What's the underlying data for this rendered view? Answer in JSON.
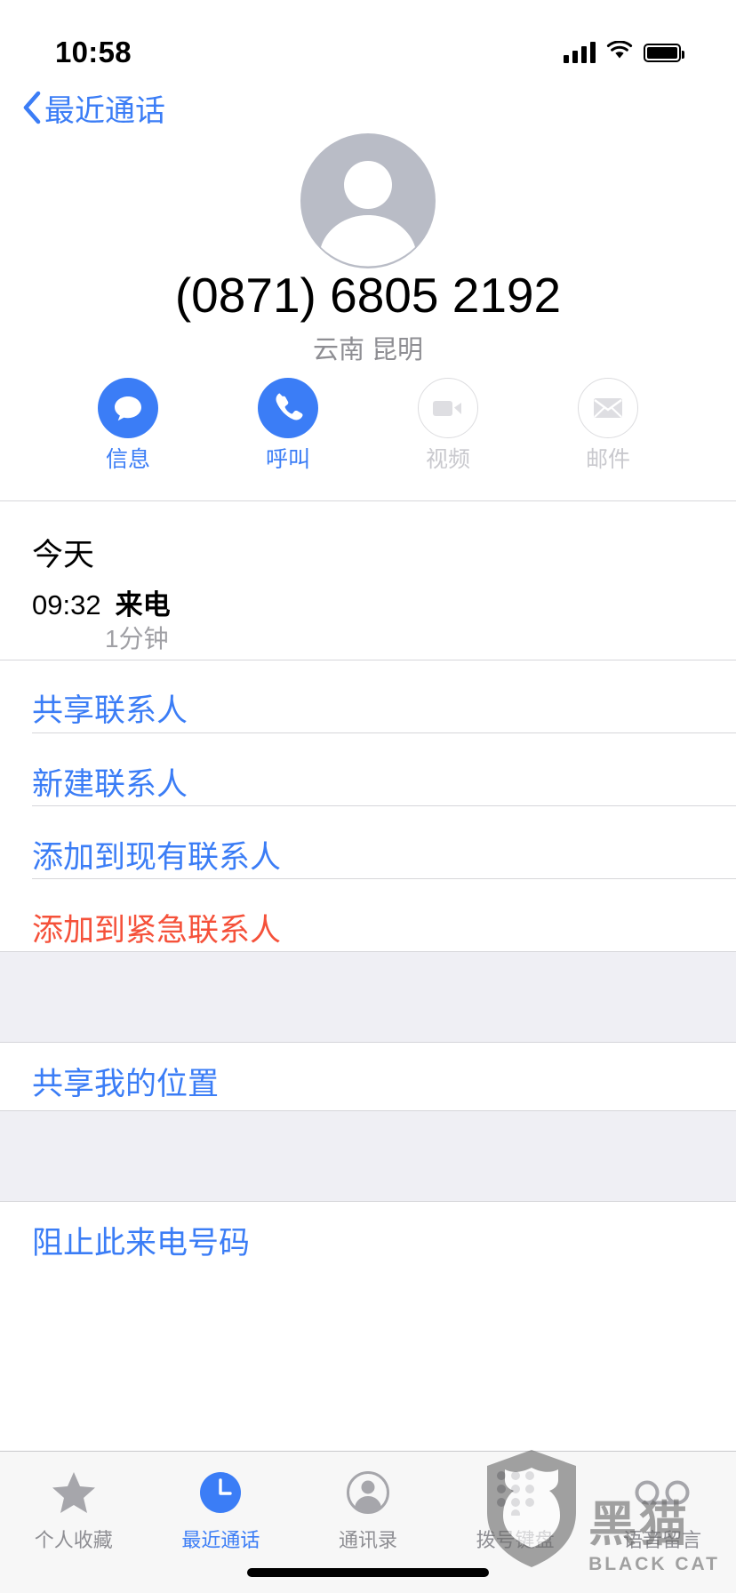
{
  "status_bar": {
    "time": "10:58",
    "signal_icon": "cellular-bars-icon",
    "wifi_icon": "wifi-icon",
    "battery_icon": "battery-full-icon"
  },
  "nav": {
    "back_label": "最近通话",
    "back_icon": "chevron-left-icon",
    "accent_color": "#3b7df6"
  },
  "contact": {
    "avatar_icon": "person-placeholder-avatar-icon",
    "phone_number": "(0871) 6805 2192",
    "region": "云南 昆明"
  },
  "actions": [
    {
      "label": "信息",
      "icon": "message-bubble-icon",
      "enabled": true
    },
    {
      "label": "呼叫",
      "icon": "phone-handset-icon",
      "enabled": true
    },
    {
      "label": "视频",
      "icon": "video-camera-icon",
      "enabled": false
    },
    {
      "label": "邮件",
      "icon": "envelope-icon",
      "enabled": false
    }
  ],
  "call_log": {
    "section_title": "今天",
    "entry": {
      "time": "09:32",
      "type": "来电",
      "duration": "1分钟"
    }
  },
  "list_groups": [
    {
      "items": [
        {
          "label": "共享联系人",
          "style": "blue"
        },
        {
          "label": "新建联系人",
          "style": "blue"
        },
        {
          "label": "添加到现有联系人",
          "style": "blue"
        },
        {
          "label": "添加到紧急联系人",
          "style": "red"
        }
      ]
    },
    {
      "items": [
        {
          "label": "共享我的位置",
          "style": "blue"
        }
      ]
    },
    {
      "items": [
        {
          "label": "阻止此来电号码",
          "style": "blue"
        }
      ]
    }
  ],
  "tabs": [
    {
      "label": "个人收藏",
      "icon": "star-icon",
      "active": false
    },
    {
      "label": "最近通话",
      "icon": "clock-icon",
      "active": true
    },
    {
      "label": "通讯录",
      "icon": "contacts-person-icon",
      "active": false
    },
    {
      "label": "拨号键盘",
      "icon": "keypad-dots-icon",
      "active": false
    },
    {
      "label": "语音留言",
      "icon": "voicemail-icon",
      "active": false
    }
  ],
  "watermark": {
    "logo_icon": "black-cat-shield-icon",
    "cn": "黑猫",
    "en": "BLACK CAT"
  },
  "colors": {
    "accent": "#3b7df6",
    "destructive": "#f5513a",
    "muted": "#8e8e93",
    "separator": "#d6d6da",
    "group_bg": "#efeff4"
  }
}
